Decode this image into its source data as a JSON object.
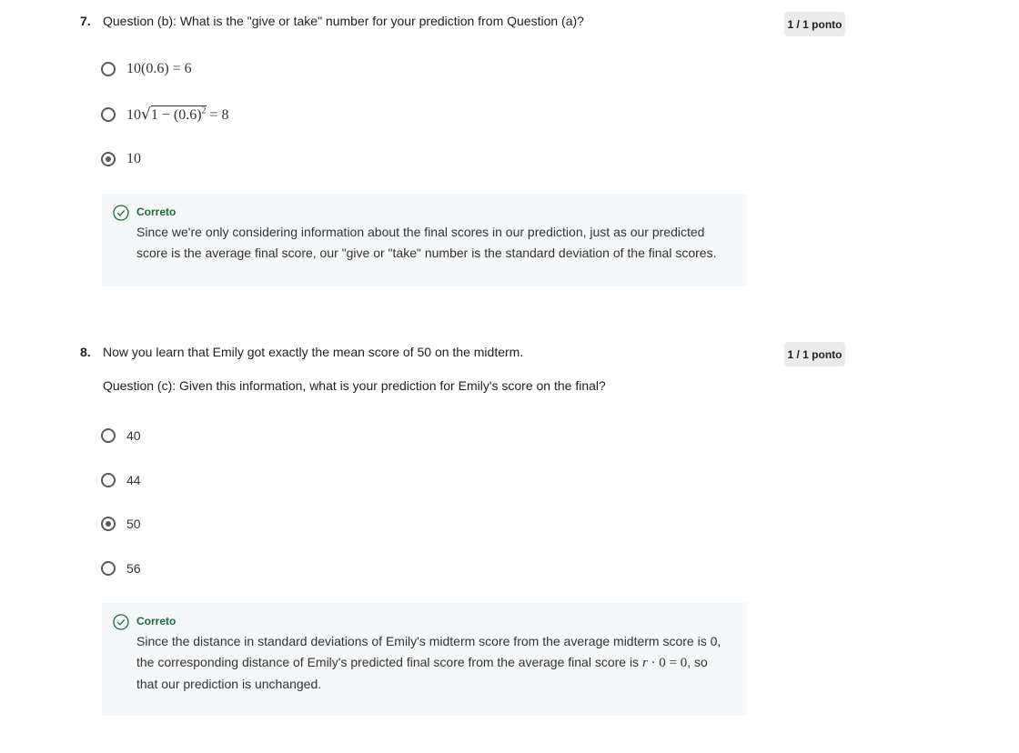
{
  "q7": {
    "number": "7.",
    "text": "Question (b):  What is the \"give or take\" number for your prediction from Question (a)?",
    "score": "1 / 1 ponto",
    "options": [
      {
        "label": "10(0.6) = 6",
        "selected": false
      },
      {
        "label_prefix": "10",
        "label_radicand": "1 − (0.6)",
        "label_exp": "2",
        "label_suffix": " = 8",
        "selected": false
      },
      {
        "label": "10",
        "selected": true
      }
    ],
    "feedback": {
      "status": "Correto",
      "text": "Since we're only considering information about the final scores in our prediction, just as our predicted score is the average final score, our \"give or \"take\" number is the standard deviation of the final scores."
    }
  },
  "q8": {
    "number": "8.",
    "text": "Now you learn that Emily got exactly the mean score of 50 on the midterm.",
    "subtext": "Question (c):  Given this information, what is your prediction for Emily's score on the final?",
    "score": "1 / 1 ponto",
    "options": [
      {
        "label": "40",
        "selected": false
      },
      {
        "label": "44",
        "selected": false
      },
      {
        "label": "50",
        "selected": true
      },
      {
        "label": "56",
        "selected": false
      }
    ],
    "feedback": {
      "status": "Correto",
      "text_before": "Since the distance in standard deviations of Emily's midterm score from the average midterm score is 0, the corresponding distance of Emily's predicted final score from the average final score is ",
      "math_var": "r",
      "math_rest": " · 0 = 0",
      "text_after": ", so that our prediction is unchanged."
    }
  },
  "colors": {
    "correct_green": "#1d6b3a",
    "feedback_bg": "#f5f7f8",
    "badge_bg": "#ebebeb"
  },
  "icons": {
    "feedback": "check-circle-icon"
  }
}
